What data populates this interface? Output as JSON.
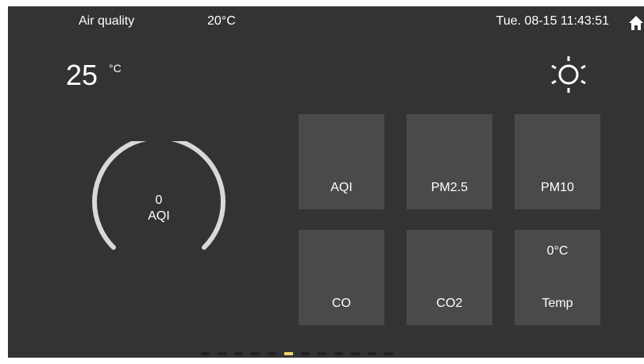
{
  "header": {
    "title": "Air quality",
    "outdoor_temp": "20°C",
    "datetime": "Tue. 08-15 11:43:51",
    "home_icon": "home-icon"
  },
  "current": {
    "temperature": "25",
    "unit": "°C",
    "weather_icon": "sun-icon"
  },
  "gauge": {
    "value": "0",
    "label": "AQI"
  },
  "tiles": [
    {
      "label": "AQI",
      "value": ""
    },
    {
      "label": "PM2.5",
      "value": ""
    },
    {
      "label": "PM10",
      "value": ""
    },
    {
      "label": "CO",
      "value": ""
    },
    {
      "label": "CO2",
      "value": ""
    },
    {
      "label": "Temp",
      "value": "0°C"
    }
  ],
  "pagination": {
    "total_pages": 12,
    "active_page": 6
  },
  "colors": {
    "background": "#333333",
    "tile": "#4a4a4a",
    "gauge_track": "#d9d9d9",
    "active_dot": "#f0d36a",
    "inactive_dot": "#222222"
  }
}
